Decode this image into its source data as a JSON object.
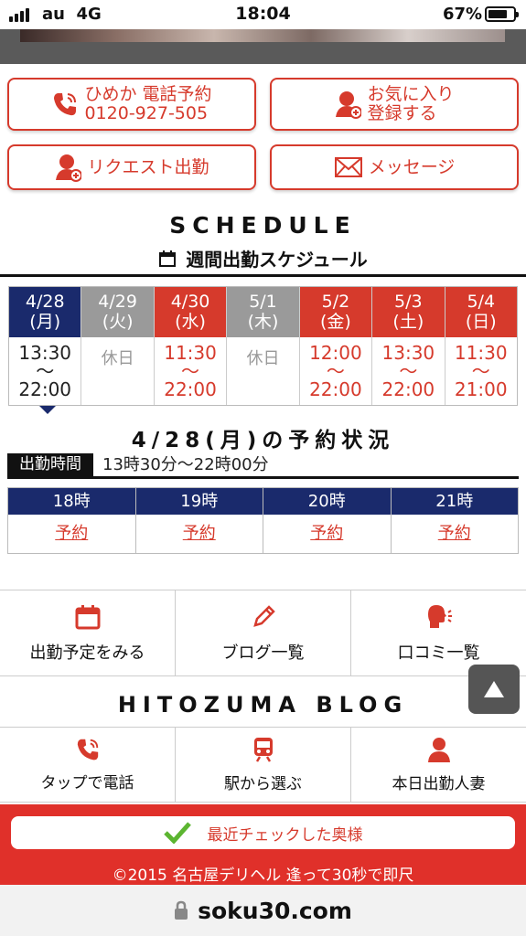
{
  "status_bar": {
    "carrier": "au",
    "network": "4G",
    "time": "18:04",
    "battery": "67%",
    "battery_level": 0.67
  },
  "actions": {
    "call_line1": "ひめか 電話予約",
    "call_line2": "0120-927-505",
    "fav_line1": "お気に入り",
    "fav_line2": "登録する",
    "request": "リクエスト出勤",
    "message": "メッセージ"
  },
  "schedule": {
    "title": "SCHEDULE",
    "subtitle": "週間出勤スケジュール",
    "days": [
      {
        "date": "4/28",
        "weekday": "(月)",
        "start": "13:30",
        "sep": "〜",
        "end": "22:00",
        "color": "#1a2a6c"
      },
      {
        "date": "4/29",
        "weekday": "(火)",
        "off": "休日",
        "color": "#9a9a9a"
      },
      {
        "date": "4/30",
        "weekday": "(水)",
        "start": "11:30",
        "sep": "〜",
        "end": "22:00",
        "color": "#d63a2c"
      },
      {
        "date": "5/1",
        "weekday": "(木)",
        "off": "休日",
        "color": "#9a9a9a"
      },
      {
        "date": "5/2",
        "weekday": "(金)",
        "start": "12:00",
        "sep": "〜",
        "end": "22:00",
        "color": "#d63a2c"
      },
      {
        "date": "5/3",
        "weekday": "(土)",
        "start": "13:30",
        "sep": "〜",
        "end": "22:00",
        "color": "#d63a2c"
      },
      {
        "date": "5/4",
        "weekday": "(日)",
        "start": "11:30",
        "sep": "〜",
        "end": "21:00",
        "color": "#d63a2c"
      }
    ]
  },
  "reservation": {
    "title": "4/28(月)の予約状況",
    "work_label": "出勤時間",
    "work_time": "13時30分〜22時00分",
    "slots": [
      {
        "hour": "18時",
        "link": "予約"
      },
      {
        "hour": "19時",
        "link": "予約"
      },
      {
        "hour": "20時",
        "link": "予約"
      },
      {
        "hour": "21時",
        "link": "予約"
      }
    ]
  },
  "menu": {
    "schedule": "出勤予定をみる",
    "blog": "ブログ一覧",
    "reviews": "口コミ一覧"
  },
  "blog_title": "HITOZUMA BLOG",
  "nav": {
    "tel": "タップで電話",
    "station": "駅から選ぶ",
    "today": "本日出勤人妻"
  },
  "footer": {
    "recent": "最近チェックした奥様",
    "copyright": "©2015 名古屋デリヘル 逢って30秒で即尺"
  },
  "url": "soku30.com",
  "colors": {
    "accent": "#d63a2c",
    "navy": "#1a2a6c",
    "holiday": "#9a9a9a"
  }
}
